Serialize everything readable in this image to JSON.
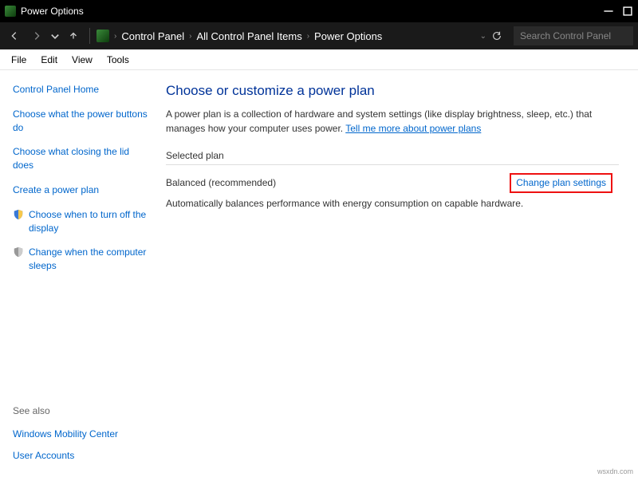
{
  "titlebar": {
    "title": "Power Options"
  },
  "breadcrumb": {
    "items": [
      "Control Panel",
      "All Control Panel Items",
      "Power Options"
    ]
  },
  "search": {
    "placeholder": "Search Control Panel"
  },
  "menu": {
    "file": "File",
    "edit": "Edit",
    "view": "View",
    "tools": "Tools"
  },
  "sidebar": {
    "home": "Control Panel Home",
    "items": [
      "Choose what the power buttons do",
      "Choose what closing the lid does",
      "Create a power plan",
      "Choose when to turn off the display",
      "Change when the computer sleeps"
    ],
    "see_also_label": "See also",
    "see_also": [
      "Windows Mobility Center",
      "User Accounts"
    ]
  },
  "main": {
    "heading": "Choose or customize a power plan",
    "desc_prefix": "A power plan is a collection of hardware and system settings (like display brightness, sleep, etc.) that manages how your computer uses power. ",
    "desc_link": "Tell me more about power plans",
    "section_label": "Selected plan",
    "plan_name": "Balanced (recommended)",
    "change_link": "Change plan settings",
    "plan_desc": "Automatically balances performance with energy consumption on capable hardware."
  },
  "footer": "wsxdn.com"
}
